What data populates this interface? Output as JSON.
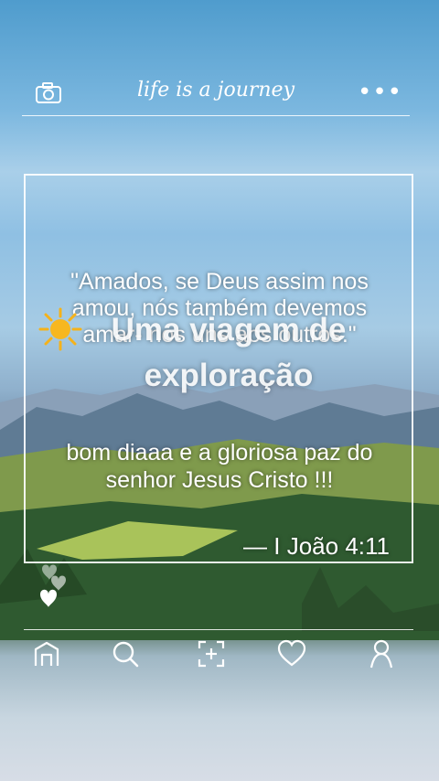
{
  "header": {
    "title": "life is a journey",
    "camera_icon": "camera-icon",
    "more_icon": "more-dots-icon",
    "more_label": "•••"
  },
  "post": {
    "quote": "\"Amados, se Deus assim nos amou, nós também devemos amar- nos uns aos outros.\"",
    "greeting": "bom diaaa e a gloriosa paz do senhor Jesus Cristo !!!",
    "reference": "— I João 4:11"
  },
  "overlay": {
    "caption": "Uma viagem de exploração",
    "sun_icon": "sun-emoji"
  },
  "reactions": {
    "icon": "floating-hearts-icon"
  },
  "nav": {
    "items": [
      {
        "name": "home",
        "icon": "home-icon"
      },
      {
        "name": "search",
        "icon": "search-icon"
      },
      {
        "name": "add",
        "icon": "add-post-icon"
      },
      {
        "name": "likes",
        "icon": "heart-icon"
      },
      {
        "name": "profile",
        "icon": "profile-icon"
      }
    ]
  }
}
